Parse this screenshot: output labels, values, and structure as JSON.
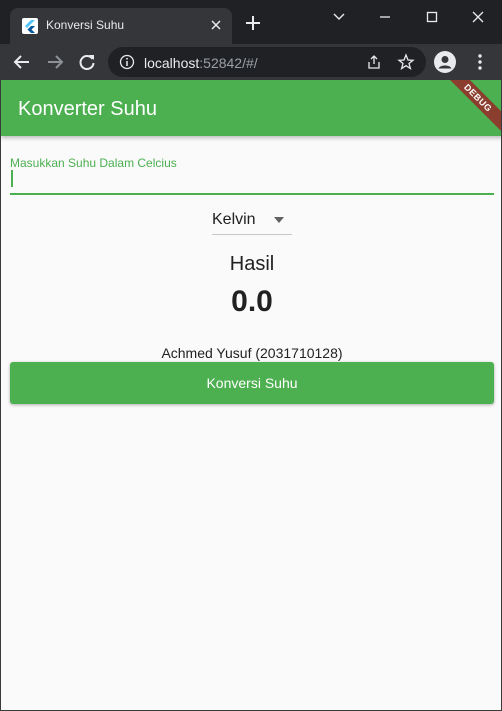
{
  "browser": {
    "tab_title": "Konversi Suhu",
    "url_host": "localhost",
    "url_rest": ":52842/#/"
  },
  "icons": {
    "favicon": "flutter-logo-icon",
    "tab_close": "close-icon",
    "new_tab": "plus-icon",
    "back": "arrow-left-icon",
    "forward": "arrow-right-icon",
    "reload": "reload-icon",
    "info": "info-icon",
    "share": "share-icon",
    "bookmark": "star-icon",
    "profile": "account-icon",
    "menu": "more-vert-icon",
    "dropdown": "caret-down-icon"
  },
  "app": {
    "title": "Konverter Suhu",
    "debug_banner": "DEBUG",
    "input": {
      "label": "Masukkan Suhu Dalam Celcius",
      "value": ""
    },
    "unit_dropdown": {
      "selected": "Kelvin"
    },
    "result": {
      "label": "Hasil",
      "value": "0.0"
    },
    "author": "Achmed Yusuf (2031710128)",
    "convert_button": "Konversi Suhu"
  },
  "colors": {
    "primary": "#4caf50",
    "background": "#fafafa",
    "debug": "#8b3d2e"
  }
}
